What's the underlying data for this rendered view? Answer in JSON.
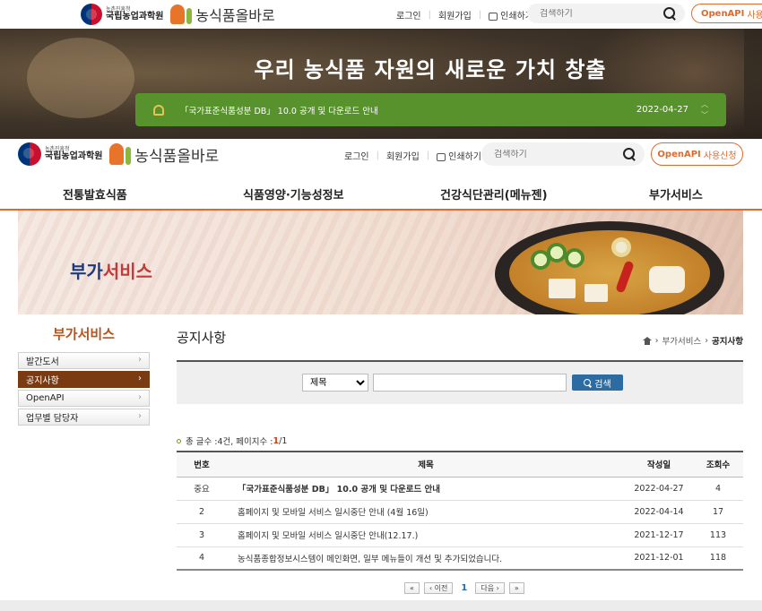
{
  "top_header": {
    "org_small": "농촌진흥청",
    "org_name": "국립농업과학원",
    "brand": "농식품올바로",
    "login": "로그인",
    "signup": "회원가입",
    "print": "인쇄하기",
    "search_placeholder": "검색하기",
    "openapi": "OpenAPI",
    "openapi_suffix": "사용신"
  },
  "hero": {
    "title": "우리 농식품 자원의 새로운 가치 창출",
    "notice_text": "「국가표준식품성분 DB」 10.0 공개 및 다운로드 안내",
    "notice_date": "2022-04-27"
  },
  "header": {
    "org_small": "농촌진흥청",
    "org_name": "국립농업과학원",
    "brand": "농식품올바로",
    "login": "로그인",
    "signup": "회원가입",
    "print": "인쇄하기",
    "search_placeholder": "검색하기",
    "openapi": "OpenAPI",
    "openapi_suffix": "사용신청"
  },
  "gnb": [
    "전통발효식품",
    "식품영양·기능성정보",
    "건강식단관리(메뉴젠)",
    "부가서비스"
  ],
  "sub_visual": {
    "title_part1": "부가",
    "title_part2": "서비스"
  },
  "lnb": {
    "title": "부가서비스",
    "items": [
      "발간도서",
      "공지사항",
      "OpenAPI",
      "업무별 담당자"
    ]
  },
  "content": {
    "title": "공지사항",
    "breadcrumb": [
      "부가서비스",
      "공지사항"
    ]
  },
  "search": {
    "select_value": "제목",
    "button": "검색"
  },
  "total": {
    "label": "총 글수 : ",
    "count": "4건",
    "pages_label": ", 페이지수 : ",
    "current_page": "1",
    "total_pages": "/1"
  },
  "table": {
    "headers": [
      "번호",
      "제목",
      "작성일",
      "조회수"
    ],
    "rows": [
      {
        "no": "중요",
        "title": "「국가표준식품성분 DB」 10.0 공개 및 다운로드 안내",
        "date": "2022-04-27",
        "views": "4"
      },
      {
        "no": "2",
        "title": "홈페이지 및 모바일 서비스 일시중단 안내 (4월 16일)",
        "date": "2022-04-14",
        "views": "17"
      },
      {
        "no": "3",
        "title": "홈페이지 및 모바일 서비스 일시중단 안내(12.17.)",
        "date": "2021-12-17",
        "views": "113"
      },
      {
        "no": "4",
        "title": "농식품종합정보시스템이 메인화면, 일부 메뉴들이 개선 및 추가되었습니다.",
        "date": "2021-12-01",
        "views": "118"
      }
    ]
  },
  "pager": {
    "first": "«",
    "prev": "‹ 이전",
    "current": "1",
    "next": "다음 ›",
    "last": "»"
  },
  "colors": {
    "accent": "#e06a2c",
    "notice_green": "#58922c",
    "lnb_active": "#7a3b12",
    "search_button": "#2c6ca3"
  }
}
